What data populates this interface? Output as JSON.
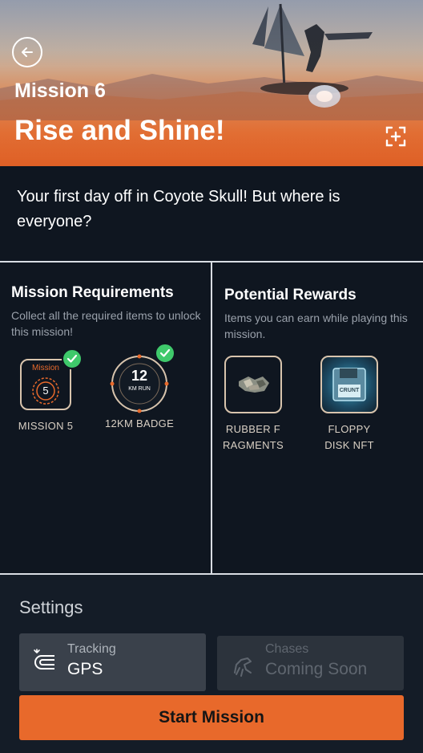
{
  "header": {
    "mission_number": "Mission 6",
    "title": "Rise and Shine!",
    "back_icon": "back-arrow-icon",
    "expand_icon": "expand-icon"
  },
  "description": "Your first day off in Coyote Skull! But where is everyone?",
  "requirements": {
    "title": "Mission Requirements",
    "subtitle": "Collect all the required items to unlock this mission!",
    "items": [
      {
        "label": "MISSION 5",
        "badge_top": "Mission",
        "badge_value": "5",
        "completed": true
      },
      {
        "label": "12KM BADGE",
        "badge_value": "12",
        "badge_sub": "KM RUN",
        "completed": true
      }
    ]
  },
  "rewards": {
    "title": "Potential Rewards",
    "subtitle": "Items you can earn while playing this mission.",
    "items": [
      {
        "label": "RUBBER F RAGMENTS",
        "icon": "rubber-fragments-icon"
      },
      {
        "label": "FLOPPY DISK NFT",
        "icon": "floppy-disk-icon",
        "disk_text": "CRUNT"
      }
    ]
  },
  "settings": {
    "title": "Settings",
    "tracking": {
      "label": "Tracking",
      "value": "GPS",
      "icon": "gps-track-icon"
    },
    "chases": {
      "label": "Chases",
      "value": "Coming Soon",
      "icon": "dino-icon"
    },
    "start_button": "Start Mission"
  },
  "colors": {
    "accent": "#e8692b",
    "background": "#0f1620",
    "check": "#3fc96b",
    "frame": "#d8c4ad"
  }
}
